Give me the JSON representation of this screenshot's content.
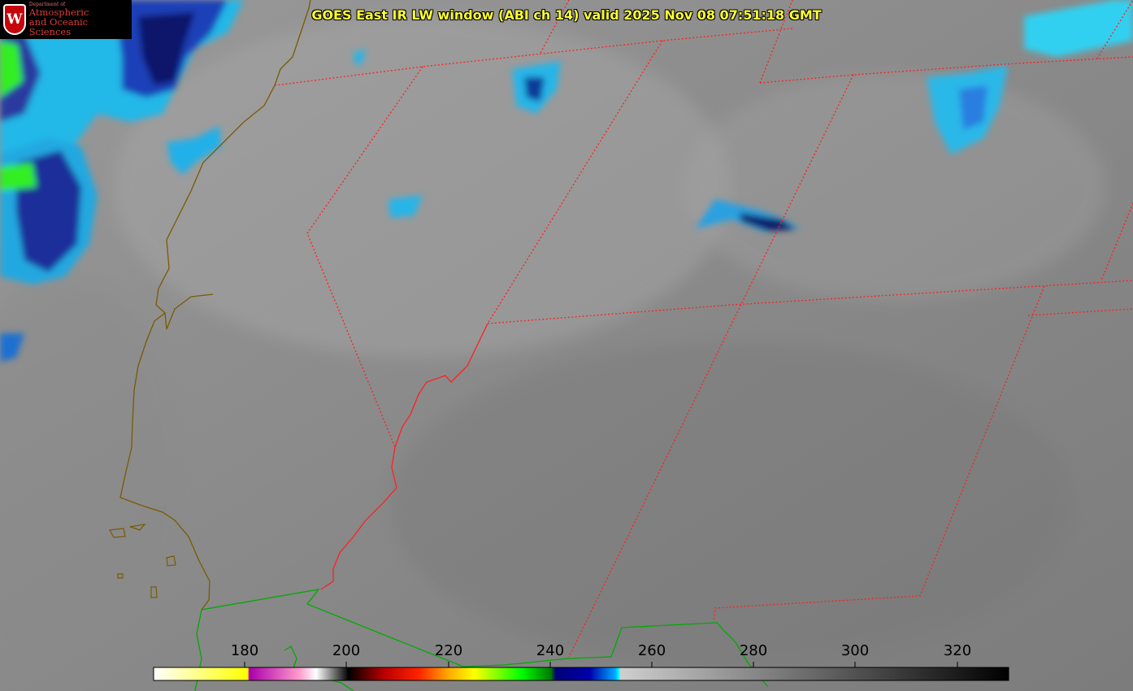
{
  "title": "GOES East IR LW window (ABI ch 14) valid 2025 Nov 08 07:51:18 GMT",
  "logo": {
    "department": "Department of",
    "line1": "Atmospheric",
    "line2": "and Oceanic Sciences",
    "crest_letter": "W"
  },
  "colorbar": {
    "ticks": [
      "180",
      "200",
      "220",
      "240",
      "260",
      "280",
      "300",
      "320"
    ],
    "stops": [
      {
        "color": "#ffffff"
      },
      {
        "color": "#ffff00"
      },
      {
        "color": "#aa00aa"
      },
      {
        "color": "#ff99cc"
      },
      {
        "color": "#ffffff"
      },
      {
        "color": "#000000"
      },
      {
        "color": "#aa0000"
      },
      {
        "color": "#ff0000"
      },
      {
        "color": "#ffaa00"
      },
      {
        "color": "#ffff00"
      },
      {
        "color": "#00ff00"
      },
      {
        "color": "#007700"
      },
      {
        "color": "#000088"
      },
      {
        "color": "#0088ff"
      },
      {
        "color": "#00ffff"
      },
      {
        "color": "#bbbbbb"
      },
      {
        "color": "#000000"
      }
    ]
  },
  "colors": {
    "state_border": "#ff2020",
    "coast": "#7a5a00",
    "country_border": "#00aa00",
    "title_text": "#ffff33"
  }
}
